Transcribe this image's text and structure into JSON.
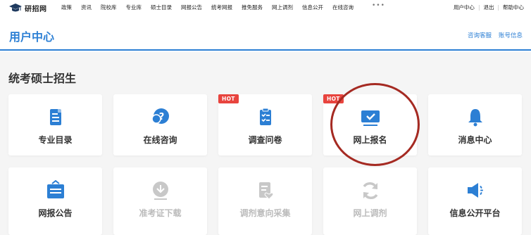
{
  "topnav": {
    "logo_text": "研招网",
    "links": [
      "政策",
      "资讯",
      "院校库",
      "专业库",
      "硕士目录",
      "网报公告",
      "统考网报",
      "推免服务",
      "网上调剂",
      "信息公开",
      "在线咨询"
    ],
    "more": "•••",
    "right": [
      "用户中心",
      "退出",
      "帮助中心"
    ]
  },
  "header": {
    "title": "用户中心",
    "links": [
      "咨询客服",
      "账号信息"
    ]
  },
  "section": {
    "title": "统考硕士招生"
  },
  "tiles": [
    {
      "label": "专业目录",
      "icon": "doc-list-icon",
      "enabled": true,
      "hot": false
    },
    {
      "label": "在线咨询",
      "icon": "question-chat-icon",
      "enabled": true,
      "hot": false
    },
    {
      "label": "调查问卷",
      "icon": "clipboard-check-icon",
      "enabled": true,
      "hot": true
    },
    {
      "label": "网上报名",
      "icon": "monitor-check-icon",
      "enabled": true,
      "hot": true
    },
    {
      "label": "消息中心",
      "icon": "bell-icon",
      "enabled": true,
      "hot": false
    },
    {
      "label": "网报公告",
      "icon": "announcement-board-icon",
      "enabled": true,
      "hot": false
    },
    {
      "label": "准考证下载",
      "icon": "download-circle-icon",
      "enabled": false,
      "hot": false
    },
    {
      "label": "调剂意向采集",
      "icon": "form-heart-icon",
      "enabled": false,
      "hot": false
    },
    {
      "label": "网上调剂",
      "icon": "refresh-icon",
      "enabled": false,
      "hot": false
    },
    {
      "label": "信息公开平台",
      "icon": "megaphone-icon",
      "enabled": true,
      "hot": false
    }
  ],
  "hot_label": "HOT",
  "colors": {
    "primary": "#2c7fd4",
    "disabled": "#c8c8c8",
    "hot": "#e8443e",
    "annotation_circle": "#a52a22"
  }
}
